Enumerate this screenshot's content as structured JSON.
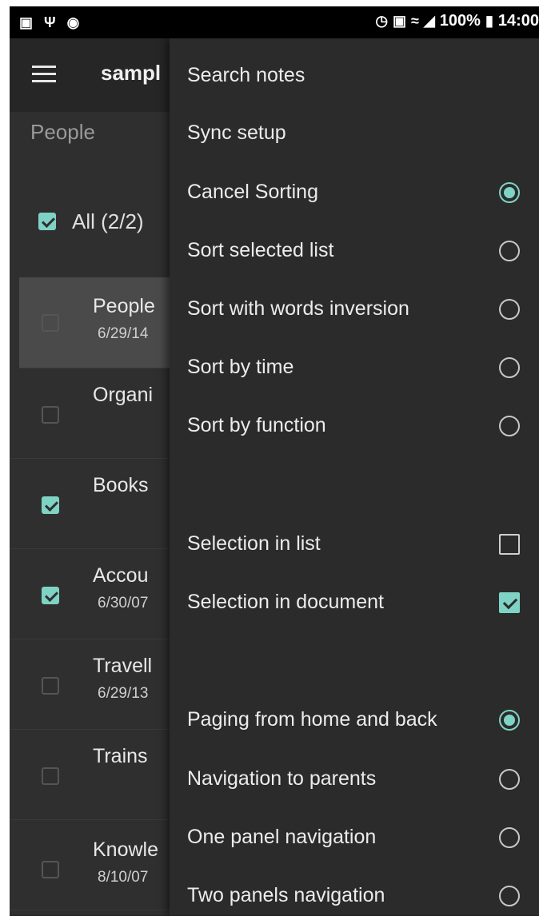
{
  "status_bar": {
    "left_icons": [
      "image-icon",
      "usb-icon",
      "circle-icon"
    ],
    "battery": "100%",
    "time": "14:00"
  },
  "app_bar": {
    "title": "sampl"
  },
  "list": {
    "header": "People",
    "all_label": "All (2/2)",
    "items": [
      {
        "title": "People",
        "date": "6/29/14",
        "checked": false
      },
      {
        "title": "Organi",
        "date": "",
        "checked": false
      },
      {
        "title": "Books",
        "date": "",
        "checked": true
      },
      {
        "title": "Accou",
        "date": "6/30/07",
        "checked": true
      },
      {
        "title": "Travell",
        "date": "6/29/13",
        "checked": false
      },
      {
        "title": "Trains",
        "date": "",
        "checked": false
      },
      {
        "title": "Knowle",
        "date": "8/10/07",
        "checked": false
      }
    ]
  },
  "menu": {
    "search_notes": "Search notes",
    "sync_setup": "Sync setup",
    "sort_options": [
      {
        "label": "Cancel Sorting",
        "selected": true
      },
      {
        "label": "Sort selected list",
        "selected": false
      },
      {
        "label": "Sort with words inversion",
        "selected": false
      },
      {
        "label": "Sort by time",
        "selected": false
      },
      {
        "label": "Sort by function",
        "selected": false
      }
    ],
    "selection_options": [
      {
        "label": "Selection in list",
        "checked": false
      },
      {
        "label": "Selection in document",
        "checked": true
      }
    ],
    "navigation_options": [
      {
        "label": "Paging from home and back",
        "selected": true
      },
      {
        "label": "Navigation to parents",
        "selected": false
      },
      {
        "label": "One panel navigation",
        "selected": false
      },
      {
        "label": "Two panels navigation",
        "selected": false
      }
    ]
  },
  "colors": {
    "accent": "#7fd3c4",
    "background": "#2f2f2f",
    "menu_background": "#2b2b2b"
  }
}
